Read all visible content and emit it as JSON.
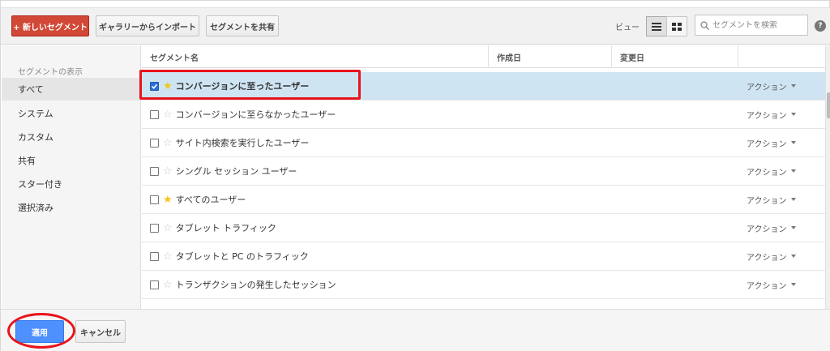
{
  "toolbar": {
    "new_segment": "+ 新しいセグメント",
    "import_gallery": "ギャラリーからインポート",
    "share_segment": "セグメントを共有",
    "view_label": "ビュー",
    "search_placeholder": "セグメントを検索",
    "help": "?"
  },
  "sidebar": {
    "title": "セグメントの表示",
    "items": [
      {
        "label": "すべて"
      },
      {
        "label": "システム"
      },
      {
        "label": "カスタム"
      },
      {
        "label": "共有"
      },
      {
        "label": "スター付き"
      },
      {
        "label": "選択済み"
      }
    ]
  },
  "table": {
    "headers": {
      "name": "セグメント名",
      "created": "作成日",
      "updated": "変更日"
    },
    "rows": [
      {
        "name": "コンバージョンに至ったユーザー",
        "checked": true,
        "starred": false,
        "action": "アクション"
      },
      {
        "name": "コンバージョンに至らなかったユーザー",
        "checked": false,
        "starred": false,
        "action": "アクション"
      },
      {
        "name": "サイト内検索を実行したユーザー",
        "checked": false,
        "starred": false,
        "action": "アクション"
      },
      {
        "name": "シングル セッション ユーザー",
        "checked": false,
        "starred": false,
        "action": "アクション"
      },
      {
        "name": "すべてのユーザー",
        "checked": false,
        "starred": true,
        "action": "アクション"
      },
      {
        "name": "タブレット トラフィック",
        "checked": false,
        "starred": false,
        "action": "アクション"
      },
      {
        "name": "タブレットと PC のトラフィック",
        "checked": false,
        "starred": false,
        "action": "アクション"
      },
      {
        "name": "トランザクションの発生したセッション",
        "checked": false,
        "starred": false,
        "action": "アクション"
      }
    ]
  },
  "footer": {
    "apply": "適用",
    "cancel": "キャンセル"
  },
  "colors": {
    "primary_red": "#d14836",
    "apply_blue": "#4d90fe",
    "selected_row": "#cfe4f3",
    "annotation_red": "#e8141c",
    "star_on": "#f5c518"
  }
}
